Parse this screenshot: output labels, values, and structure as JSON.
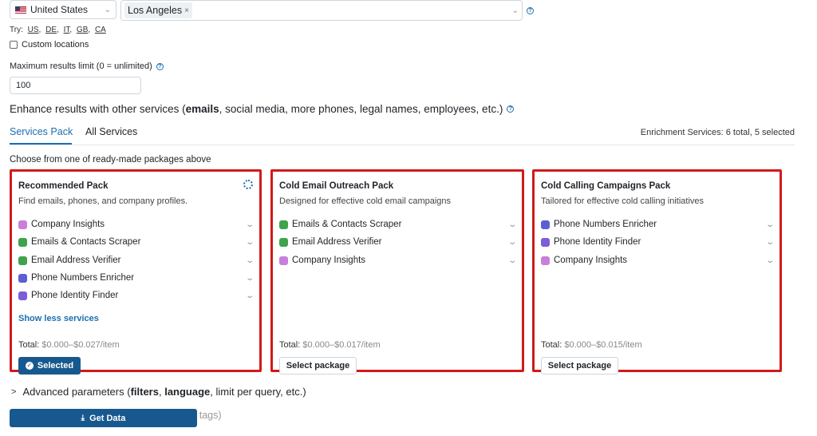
{
  "location": {
    "country": "United States",
    "city_chip": "Los Angeles",
    "try_label": "Try:",
    "try_codes": [
      "US",
      "DE",
      "IT",
      "GB",
      "CA"
    ],
    "custom_locations": "Custom locations"
  },
  "limit": {
    "label": "Maximum results limit (0 = unlimited)",
    "value": "100"
  },
  "enhance": {
    "prefix": "Enhance results with other services (",
    "bold": "emails",
    "suffix": ", social media, more phones, legal names, employees, etc.)"
  },
  "tabs": [
    {
      "label": "Services Pack"
    },
    {
      "label": "All Services"
    }
  ],
  "enrichment_summary": "Enrichment Services: 6 total, 5 selected",
  "choose_text": "Choose from one of ready-made packages above",
  "cards": [
    {
      "title": "Recommended Pack",
      "subtitle": "Find emails, phones, and company profiles.",
      "services": [
        {
          "label": "Company Insights",
          "icon": "company-icon",
          "color": "#c97fd9"
        },
        {
          "label": "Emails & Contacts Scraper",
          "icon": "email-scraper-icon",
          "color": "#3fa34d"
        },
        {
          "label": "Email Address Verifier",
          "icon": "email-verifier-icon",
          "color": "#3fa34d"
        },
        {
          "label": "Phone Numbers Enricher",
          "icon": "phone-icon",
          "color": "#5b5fd6"
        },
        {
          "label": "Phone Identity Finder",
          "icon": "phone-identity-icon",
          "color": "#7a5fd6"
        }
      ],
      "show_less": "Show less services",
      "total_label": "Total:",
      "total_value": "$0.000–$0.027/item",
      "button": "Selected"
    },
    {
      "title": "Cold Email Outreach Pack",
      "subtitle": "Designed for effective cold email campaigns",
      "services": [
        {
          "label": "Emails & Contacts Scraper",
          "icon": "email-scraper-icon",
          "color": "#3fa34d"
        },
        {
          "label": "Email Address Verifier",
          "icon": "email-verifier-icon",
          "color": "#3fa34d"
        },
        {
          "label": "Company Insights",
          "icon": "company-icon",
          "color": "#c97fd9"
        }
      ],
      "total_label": "Total:",
      "total_value": "$0.000–$0.017/item",
      "button": "Select package"
    },
    {
      "title": "Cold Calling Campaigns Pack",
      "subtitle": "Tailored for effective cold calling initiatives",
      "services": [
        {
          "label": "Phone Numbers Enricher",
          "icon": "phone-icon",
          "color": "#5b5fd6"
        },
        {
          "label": "Phone Identity Finder",
          "icon": "phone-identity-icon",
          "color": "#7a5fd6"
        },
        {
          "label": "Company Insights",
          "icon": "company-icon",
          "color": "#c97fd9"
        }
      ],
      "total_label": "Total:",
      "total_value": "$0.000–$0.015/item",
      "button": "Select package"
    }
  ],
  "advanced": {
    "prefix": "Advanced parameters (",
    "b1": "filters",
    "mid": ", ",
    "b2": "language",
    "suffix": ", limit per query, etc.)"
  },
  "hidden_text": "k tags)",
  "get_data": "Get Data",
  "colors": {
    "accent": "#1c6fb0",
    "primary_button": "#17598f",
    "highlight_border": "#d11a1a"
  }
}
